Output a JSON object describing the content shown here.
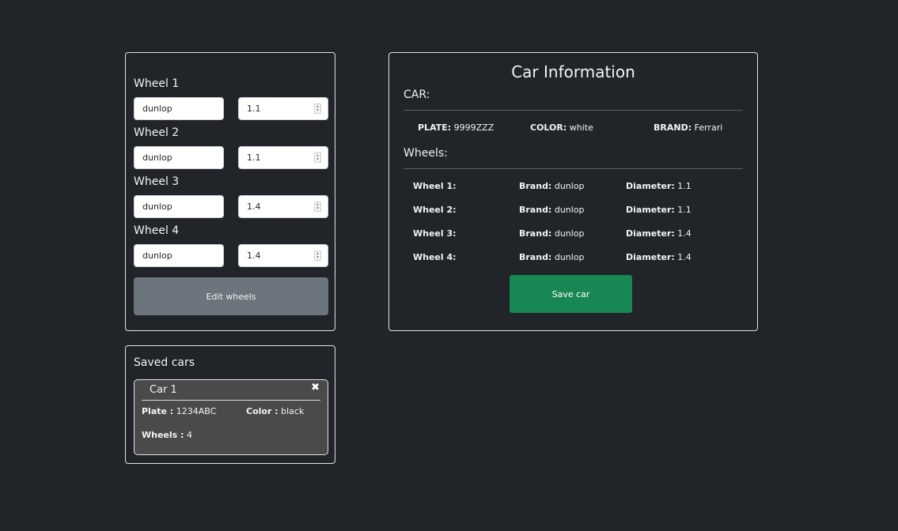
{
  "wheels_form": {
    "wheels": [
      {
        "label": "Wheel 1",
        "brand": "dunlop",
        "diameter": "1.1"
      },
      {
        "label": "Wheel 2",
        "brand": "dunlop",
        "diameter": "1.1"
      },
      {
        "label": "Wheel 3",
        "brand": "dunlop",
        "diameter": "1.4"
      },
      {
        "label": "Wheel 4",
        "brand": "dunlop",
        "diameter": "1.4"
      }
    ],
    "edit_button": "Edit wheels"
  },
  "saved_cars": {
    "title": "Saved cars",
    "cars": [
      {
        "name": "Car 1",
        "close_glyph": "✖",
        "plate_label": "Plate :",
        "plate": "1234ABC",
        "color_label": "Color :",
        "color": "black",
        "wheels_label": "Wheels :",
        "wheels": "4"
      }
    ]
  },
  "car_info": {
    "title": "Car Information",
    "car_section": "CAR:",
    "plate_label": "PLATE:",
    "plate": "9999ZZZ",
    "color_label": "COLOR:",
    "color": "white",
    "brand_label": "BRAND:",
    "brand": "Ferrari",
    "wheels_section": "Wheels:",
    "brand_field_label": "Brand:",
    "diameter_field_label": "Diameter:",
    "wheels": [
      {
        "name": "Wheel 1:",
        "brand": "dunlop",
        "diameter": "1.1"
      },
      {
        "name": "Wheel 2:",
        "brand": "dunlop",
        "diameter": "1.1"
      },
      {
        "name": "Wheel 3:",
        "brand": "dunlop",
        "diameter": "1.4"
      },
      {
        "name": "Wheel 4:",
        "brand": "dunlop",
        "diameter": "1.4"
      }
    ],
    "save_button": "Save car"
  },
  "colors": {
    "background": "#212529",
    "edit_button": "#6c757d",
    "save_button": "#198754",
    "card_background": "#4a4a4a"
  }
}
